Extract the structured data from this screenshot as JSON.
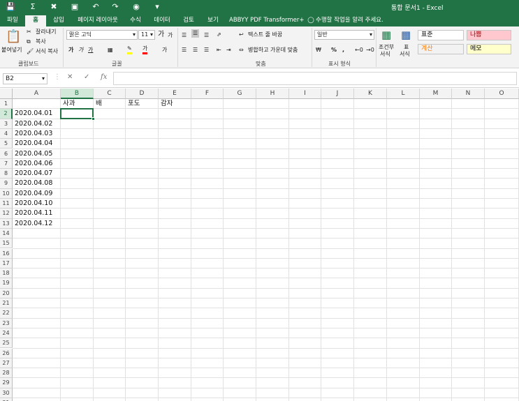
{
  "window": {
    "title": "통합 문서1 - Excel",
    "quick_access": [
      "save-icon",
      "autosum-icon",
      "close-icon",
      "save-icon",
      "undo-icon",
      "redo-icon",
      "camera-icon",
      "customize-icon"
    ]
  },
  "ribbon_tabs": [
    "파일",
    "홈",
    "삽입",
    "페이지 레이아웃",
    "수식",
    "데이터",
    "검토",
    "보기",
    "ABBYY PDF Transformer+"
  ],
  "active_tab": "홈",
  "tell_me": "수행할 작업을 알려 주세요.",
  "clipboard": {
    "paste": "붙여넣기",
    "cut": "잘라내기",
    "copy": "복사",
    "format_painter": "서식 복사",
    "label": "클립보드"
  },
  "font": {
    "name": "맑은 고딕",
    "size": "11",
    "grow": "가",
    "shrink": "가",
    "bold": "가",
    "italic": "가",
    "underline": "가",
    "font_color": "가",
    "label": "글꼴"
  },
  "alignment": {
    "wrap_text": "텍스트 줄 바꿈",
    "merge_center": "병합하고 가운데 맞춤",
    "label": "맞춤"
  },
  "number": {
    "format": "일반",
    "percent": "%",
    "comma": ",",
    "label": "표시 형식"
  },
  "styles_group": {
    "conditional_line1": "조건부",
    "conditional_line2": "서식",
    "table_line1": "표",
    "table_line2": "서식",
    "items": [
      {
        "name": "표준",
        "bg": "#ffffff",
        "fg": "#000000"
      },
      {
        "name": "나쁨",
        "bg": "#ffc7ce",
        "fg": "#9c0006"
      },
      {
        "name": "계산",
        "bg": "#f2f2f2",
        "fg": "#fa7d00"
      },
      {
        "name": "메모",
        "bg": "#ffffcc",
        "fg": "#000000"
      }
    ]
  },
  "formula_bar": {
    "name_box": "B2",
    "cancel": "✕",
    "enter": "✓",
    "fx": "fx",
    "value": ""
  },
  "columns": [
    "A",
    "B",
    "C",
    "D",
    "E",
    "F",
    "G",
    "H",
    "I",
    "J",
    "K",
    "L",
    "M",
    "N",
    "O"
  ],
  "rows": [
    "1",
    "2",
    "3",
    "4",
    "5",
    "6",
    "7",
    "8",
    "9",
    "10",
    "11",
    "12",
    "13",
    "14",
    "15",
    "16",
    "17",
    "18",
    "19",
    "20",
    "21",
    "22",
    "23",
    "24",
    "25",
    "26",
    "27",
    "28",
    "29",
    "30",
    "31"
  ],
  "cells": [
    {
      "ref": "B1",
      "col": 1,
      "row": 0,
      "value": "사과"
    },
    {
      "ref": "C1",
      "col": 2,
      "row": 0,
      "value": "배"
    },
    {
      "ref": "D1",
      "col": 3,
      "row": 0,
      "value": "포도"
    },
    {
      "ref": "E1",
      "col": 4,
      "row": 0,
      "value": "감자"
    },
    {
      "ref": "A2",
      "col": 0,
      "row": 1,
      "value": "2020.04.01"
    },
    {
      "ref": "A3",
      "col": 0,
      "row": 2,
      "value": "2020.04.02"
    },
    {
      "ref": "A4",
      "col": 0,
      "row": 3,
      "value": "2020.04.03"
    },
    {
      "ref": "A5",
      "col": 0,
      "row": 4,
      "value": "2020.04.04"
    },
    {
      "ref": "A6",
      "col": 0,
      "row": 5,
      "value": "2020.04.05"
    },
    {
      "ref": "A7",
      "col": 0,
      "row": 6,
      "value": "2020.04.06"
    },
    {
      "ref": "A8",
      "col": 0,
      "row": 7,
      "value": "2020.04.07"
    },
    {
      "ref": "A9",
      "col": 0,
      "row": 8,
      "value": "2020.04.08"
    },
    {
      "ref": "A10",
      "col": 0,
      "row": 9,
      "value": "2020.04.09"
    },
    {
      "ref": "A11",
      "col": 0,
      "row": 10,
      "value": "2020.04.10"
    },
    {
      "ref": "A12",
      "col": 0,
      "row": 11,
      "value": "2020.04.11"
    },
    {
      "ref": "A13",
      "col": 0,
      "row": 12,
      "value": "2020.04.12"
    }
  ],
  "selected": {
    "col": 1,
    "row": 1
  },
  "accent_color": "#217346"
}
